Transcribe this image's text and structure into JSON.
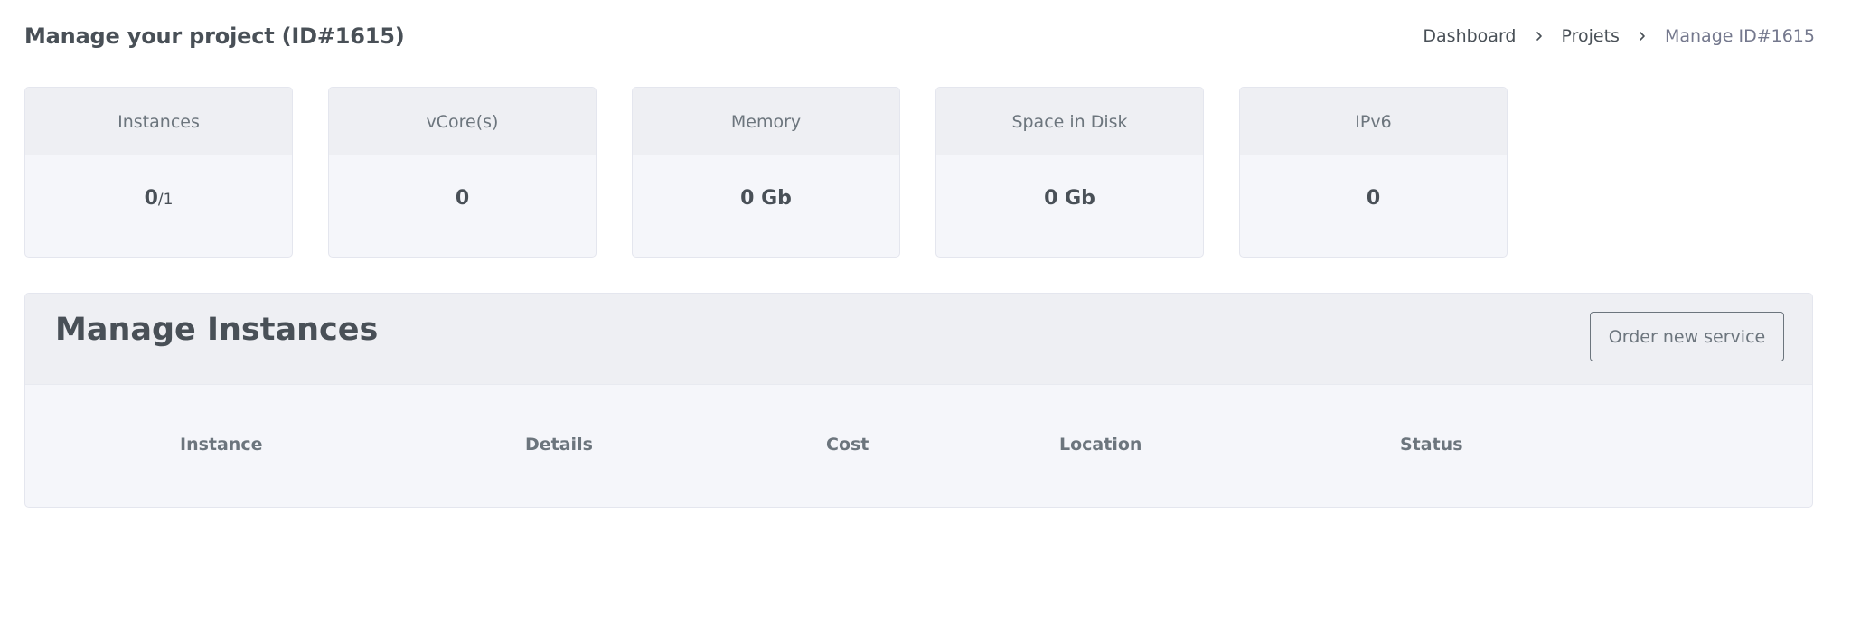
{
  "header": {
    "title": "Manage your project (ID#1615)",
    "breadcrumb": [
      "Dashboard",
      "Projets",
      "Manage ID#1615"
    ]
  },
  "stats": [
    {
      "label": "Instances",
      "value": "0",
      "sub": "/1"
    },
    {
      "label": "vCore(s)",
      "value": "0"
    },
    {
      "label": "Memory",
      "value": "0 Gb"
    },
    {
      "label": "Space in Disk",
      "value": "0 Gb"
    },
    {
      "label": "IPv6",
      "value": "0"
    }
  ],
  "instances": {
    "title": "Manage Instances",
    "order_button": "Order new service",
    "columns": [
      "Instance",
      "Details",
      "Cost",
      "Location",
      "Status"
    ]
  },
  "icons": {
    "breadcrumb_separator": "chevron-right-icon"
  }
}
